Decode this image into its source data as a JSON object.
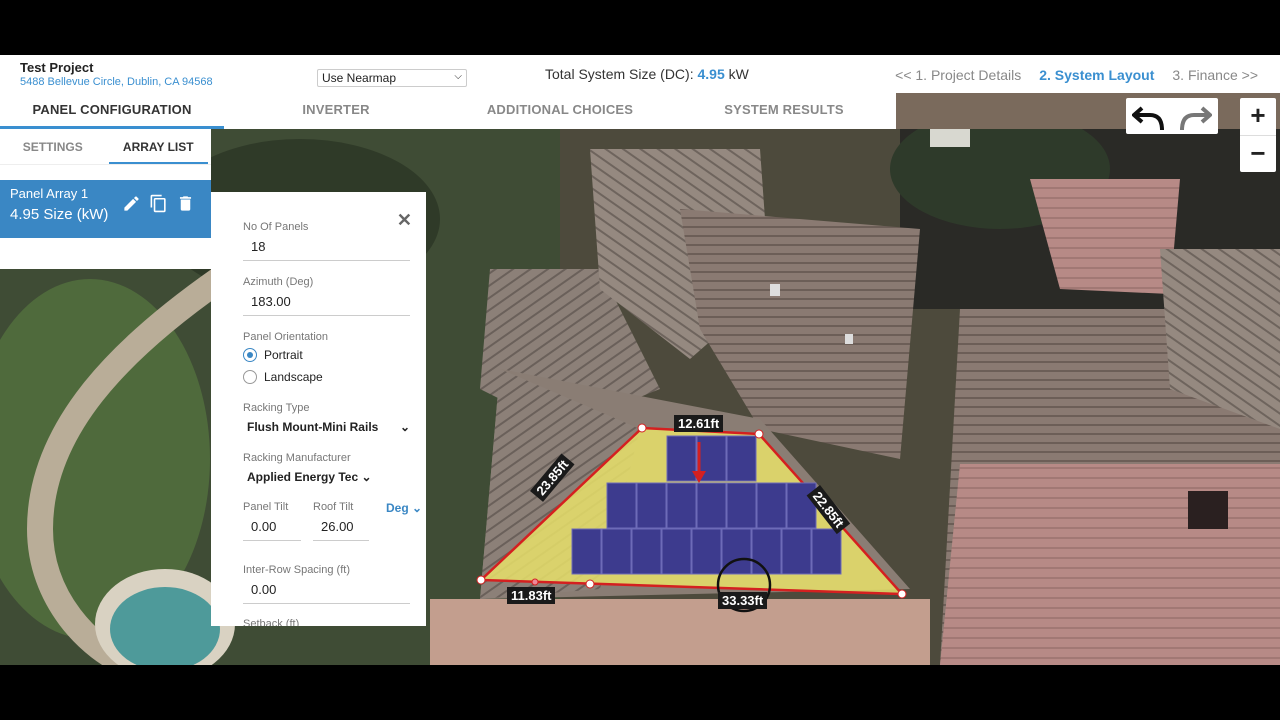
{
  "project": {
    "title": "Test Project",
    "address": "5488 Bellevue Circle, Dublin, CA 94568"
  },
  "imagery_source": {
    "selected": "Use Nearmap"
  },
  "system_size": {
    "label": "Total System Size (DC):",
    "value": "4.95",
    "unit": "kW"
  },
  "steps": [
    "<< 1. Project Details",
    "2. System Layout",
    "3. Finance >>"
  ],
  "tabs": [
    "PANEL CONFIGURATION",
    "INVERTER",
    "ADDITIONAL CHOICES",
    "SYSTEM RESULTS"
  ],
  "subtabs": [
    "SETTINGS",
    "ARRAY LIST"
  ],
  "array": {
    "name": "Panel Array 1",
    "size": "4.95 Size (kW)"
  },
  "config": {
    "num_panels_label": "No Of Panels",
    "num_panels": "18",
    "azimuth_label": "Azimuth (Deg)",
    "azimuth": "183.00",
    "orientation_label": "Panel Orientation",
    "orientation_options": [
      "Portrait",
      "Landscape"
    ],
    "racking_type_label": "Racking Type",
    "racking_type": "Flush Mount-Mini Rails",
    "racking_mfr_label": "Racking Manufacturer",
    "racking_mfr": "Applied Energy Tec",
    "panel_tilt_label": "Panel Tilt",
    "panel_tilt": "0.00",
    "roof_tilt_label": "Roof Tilt",
    "roof_tilt": "26.00",
    "units": "Deg",
    "inter_row_label": "Inter-Row Spacing (ft)",
    "inter_row": "0.00",
    "setback_label": "Setback (ft)"
  },
  "dimensions": {
    "top": "12.61ft",
    "left": "23.85ft",
    "right": "22.85ft",
    "bottom_left": "11.83ft",
    "bottom": "33.33ft"
  },
  "colors": {
    "accent": "#3a8fd0",
    "array_card": "#3a87c4",
    "polygon_fill": "#e8e06a",
    "panel_fill": "#3d3b8e",
    "outline": "#d42020"
  },
  "icons": [
    "edit-icon",
    "copy-icon",
    "delete-icon",
    "undo-icon",
    "redo-icon",
    "close-icon",
    "chevron-down-icon"
  ]
}
